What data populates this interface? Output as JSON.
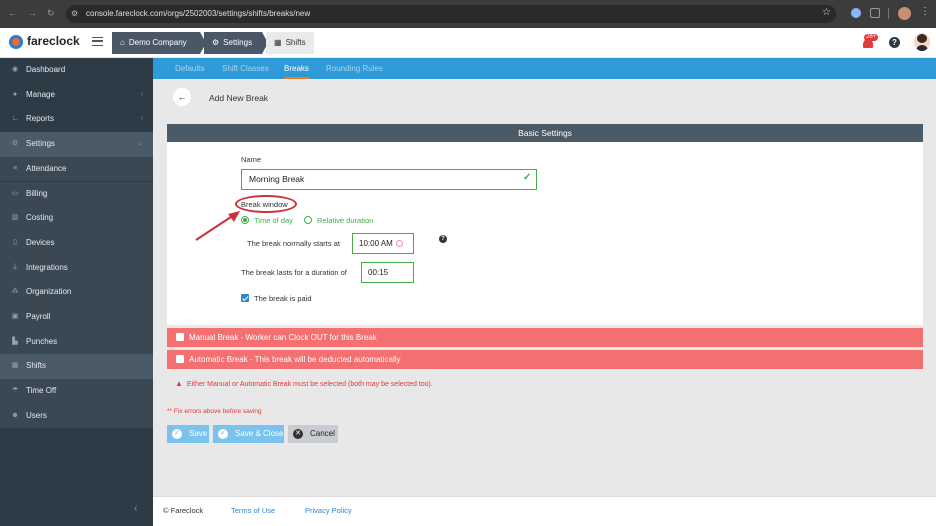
{
  "browser": {
    "url": "console.fareclock.com/orgs/2502003/settings/shifts/breaks/new"
  },
  "header": {
    "logo_text": "fareclock",
    "breadcrumbs": [
      "Demo Company",
      "Settings",
      "Shifts"
    ],
    "notification_count": "28+"
  },
  "sidebar": {
    "items": [
      {
        "label": "Dashboard",
        "icon": "dashboard-icon"
      },
      {
        "label": "Manage",
        "icon": "user-icon"
      },
      {
        "label": "Reports",
        "icon": "chart-icon"
      },
      {
        "label": "Settings",
        "icon": "gear-icon"
      },
      {
        "label": "Attendance",
        "icon": "list-icon"
      },
      {
        "label": "Billing",
        "icon": "card-icon"
      },
      {
        "label": "Costing",
        "icon": "bars-icon"
      },
      {
        "label": "Devices",
        "icon": "tablet-icon"
      },
      {
        "label": "Integrations",
        "icon": "plug-icon"
      },
      {
        "label": "Organization",
        "icon": "sitemap-icon"
      },
      {
        "label": "Payroll",
        "icon": "money-icon"
      },
      {
        "label": "Punches",
        "icon": "punch-icon"
      },
      {
        "label": "Shifts",
        "icon": "calendar-icon"
      },
      {
        "label": "Time Off",
        "icon": "umbrella-icon"
      },
      {
        "label": "Users",
        "icon": "users-icon"
      }
    ]
  },
  "tabs": [
    "Defaults",
    "Shift Classes",
    "Breaks",
    "Rounding Rules"
  ],
  "active_tab": "Breaks",
  "page_title": "Add New Break",
  "basic_settings": {
    "heading": "Basic Settings",
    "name_label": "Name",
    "name_value": "Morning Break",
    "break_window_label": "Break window",
    "option_time_of_day": "Time of day",
    "option_relative": "Relative duration",
    "starts_label": "The break normally starts at",
    "starts_value": "10:00 AM",
    "duration_label": "The break lasts for a duration of",
    "duration_value": "00:15",
    "paid_label": "The break is paid"
  },
  "manual_break": "Manual Break - Worker can Clock OUT for this Break",
  "automatic_break": "Automatic Break - This break will be deducted automatically",
  "warning": "Either Manual or Automatic Break must be selected (both may be selected too).",
  "fix_errors": "** Fix errors above before saving",
  "buttons": {
    "save": "Save",
    "save_close": "Save & Close",
    "cancel": "Cancel"
  },
  "footer": {
    "copyright": "© Fareclock",
    "terms": "Terms of Use",
    "privacy": "Privacy Policy"
  },
  "colors": {
    "sidebar_bg": "#2d3b46",
    "tab_bar": "#2e9ad8",
    "accent_green": "#3fae49",
    "break_bar_red": "#f47070",
    "annotation_red": "#c8323a"
  }
}
